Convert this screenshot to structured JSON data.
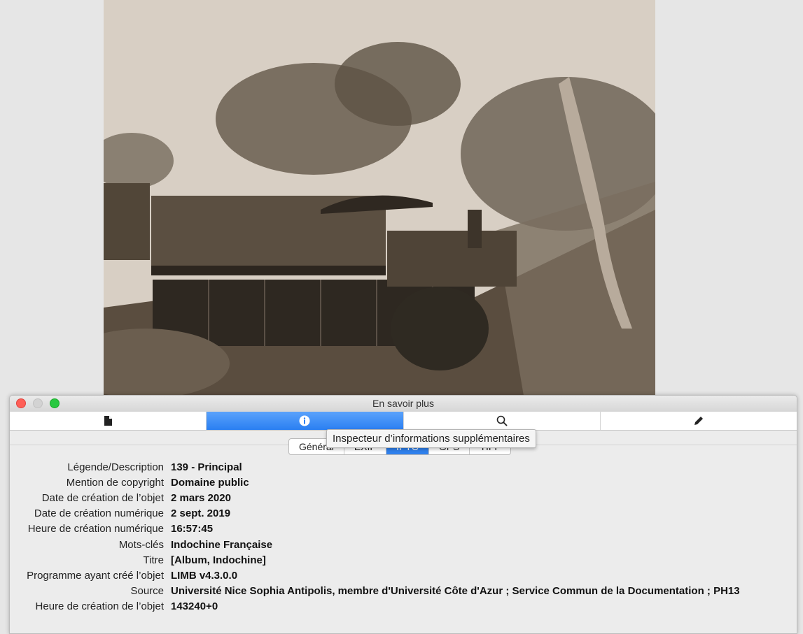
{
  "window": {
    "title": "En savoir plus"
  },
  "toolbar": {
    "buttons": [
      {
        "icon": "document-icon",
        "active": false
      },
      {
        "icon": "info-icon",
        "active": true
      },
      {
        "icon": "search-icon",
        "active": false
      },
      {
        "icon": "pencil-icon",
        "active": false
      }
    ]
  },
  "tooltip": {
    "text": "Inspecteur d’informations supplémentaires"
  },
  "segments": [
    {
      "label": "Général",
      "selected": false
    },
    {
      "label": "EXIF",
      "selected": false
    },
    {
      "label": "IPTC",
      "selected": true
    },
    {
      "label": "GPS",
      "selected": false
    },
    {
      "label": "TIFF",
      "selected": false
    }
  ],
  "metadata": [
    {
      "label": "Légende/Description",
      "value": "139 - Principal"
    },
    {
      "label": "Mention de copyright",
      "value": "Domaine public"
    },
    {
      "label": "Date de création de l’objet",
      "value": "2 mars 2020"
    },
    {
      "label": "Date de création numérique",
      "value": "2 sept. 2019"
    },
    {
      "label": "Heure de création numérique",
      "value": "16:57:45"
    },
    {
      "label": "Mots-clés",
      "value": "Indochine Française"
    },
    {
      "label": "Titre",
      "value": "[Album, Indochine]"
    },
    {
      "label": "Programme ayant créé l’objet",
      "value": "LIMB v4.3.0.0"
    },
    {
      "label": "Source",
      "value": "Université Nice Sophia Antipolis, membre d'Université Côte d'Azur ; Service Commun de la Documentation ; PH13"
    },
    {
      "label": "Heure de création de l’objet",
      "value": "143240+0"
    }
  ],
  "colors": {
    "accent": "#2f80ed",
    "close": "#fe5f57",
    "maximize": "#28c840"
  }
}
